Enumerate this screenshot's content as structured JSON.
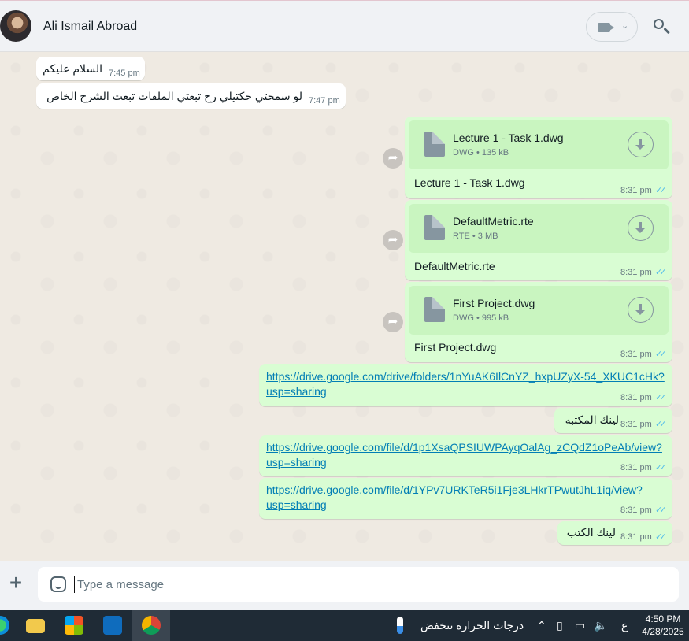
{
  "header": {
    "contact_name": "Ali Ismail Abroad"
  },
  "messages": {
    "m1": {
      "text": "السلام عليكم",
      "time": "7:45 pm"
    },
    "m2": {
      "text": "لو سمحتي حكتيلي رح تبعتي الملفات تبعت الشرح الخاص",
      "time": "7:47 pm"
    },
    "f1": {
      "file_name": "Lecture 1 - Task 1.dwg",
      "meta": "DWG • 135 kB",
      "caption": "Lecture 1 - Task 1.dwg",
      "time": "8:31 pm"
    },
    "f2": {
      "file_name": "DefaultMetric.rte",
      "meta": "RTE • 3 MB",
      "caption": "DefaultMetric.rte",
      "time": "8:31 pm"
    },
    "f3": {
      "file_name": "First Project.dwg",
      "meta": "DWG • 995 kB",
      "caption": "First Project.dwg",
      "time": "8:31 pm"
    },
    "l1": {
      "line1": "https://drive.google.com/drive/folders/1nYuAK6IlCnYZ_hxpUZyX-54_XKUC1cHk?",
      "line2": "usp=sharing",
      "time": "8:31 pm"
    },
    "t1": {
      "text": "لينك المكتبه",
      "time": "8:31 pm"
    },
    "l2": {
      "line1": "https://drive.google.com/file/d/1p1XsaQPSIUWPAyqOalAg_zCQdZ1oPeAb/view?",
      "line2": "usp=sharing",
      "time": "8:31 pm"
    },
    "l3": {
      "line1": "https://drive.google.com/file/d/1YPv7URKTeR5i1Fje3LHkrTPwutJhL1iq/view?",
      "line2": "usp=sharing",
      "time": "8:31 pm"
    },
    "t2": {
      "text": "لينك الكتب",
      "time": "8:31 pm"
    }
  },
  "composer": {
    "placeholder": "Type a message"
  },
  "taskbar": {
    "weather_text": "درجات الحرارة تنخفض",
    "lang": "ع",
    "time": "4:50 PM",
    "date": "4/28/2025"
  },
  "colors": {
    "outgoing_bubble": "#d9fdd3",
    "incoming_bubble": "#ffffff",
    "read_ticks": "#53bdeb",
    "link": "#027eb5"
  },
  "icons": [
    "video-call-icon",
    "search-icon",
    "document-icon",
    "download-icon",
    "forward-icon",
    "plus-icon",
    "sticker-icon",
    "double-check-icon"
  ]
}
